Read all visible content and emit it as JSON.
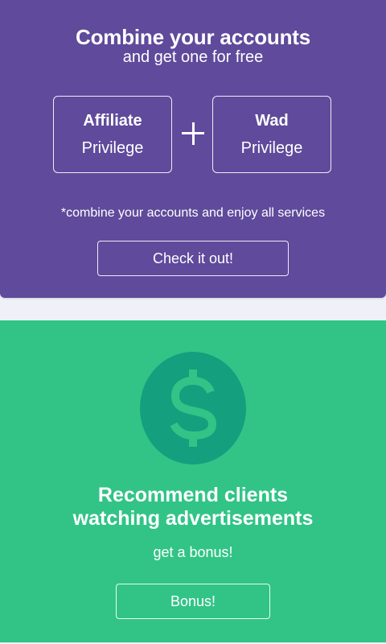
{
  "combine_card": {
    "title": "Combine your accounts",
    "subtitle": "and get one for free",
    "left_account": {
      "name": "Affiliate",
      "tier": "Privilege"
    },
    "right_account": {
      "name": "Wad",
      "tier": "Privilege"
    },
    "note": "*combine your accounts and enjoy all services",
    "button_label": "Check it out!",
    "background_color": "#5f4a9b",
    "plus_icon": "plus-icon"
  },
  "bonus_card": {
    "icon": "dollar-icon",
    "title_line1": "Recommend clients",
    "title_line2": "watching advertisements",
    "subtitle": "get a bonus!",
    "button_label": "Bonus!",
    "background_color": "#31c486",
    "icon_circle_color": "#149f7f",
    "icon_glyph_color": "#31c486"
  },
  "page": {
    "background_color": "#eef2f8"
  }
}
